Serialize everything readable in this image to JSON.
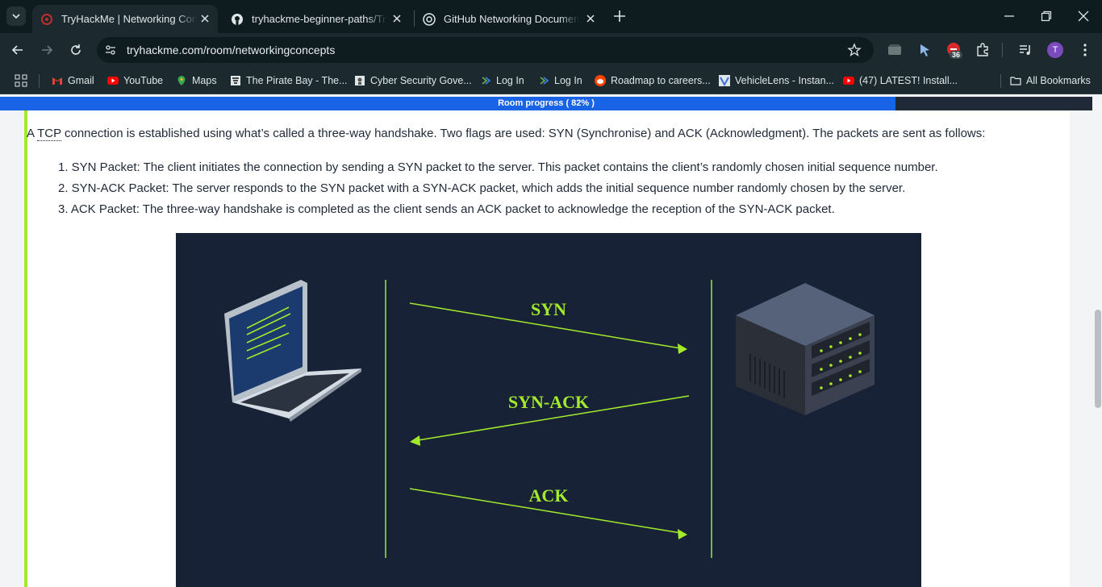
{
  "browser": {
    "tabs": [
      {
        "title": "TryHackMe | Networking Conce",
        "active": true
      },
      {
        "title": "tryhackme-beginner-paths/Tryh",
        "active": false
      },
      {
        "title": "GitHub Networking Documenta",
        "active": false
      }
    ],
    "url": "tryhackme.com/room/networkingconcepts",
    "extension_badge": "36",
    "profile_initial": "T",
    "bookmarks": [
      {
        "label": "Gmail",
        "icon": "gmail-icon"
      },
      {
        "label": "YouTube",
        "icon": "youtube-icon"
      },
      {
        "label": "Maps",
        "icon": "maps-icon"
      },
      {
        "label": "The Pirate Bay - The...",
        "icon": "piratebay-icon"
      },
      {
        "label": "Cyber Security Gove...",
        "icon": "govt-icon"
      },
      {
        "label": "Log In",
        "icon": "login-icon"
      },
      {
        "label": "Log In",
        "icon": "login-icon"
      },
      {
        "label": "Roadmap to careers...",
        "icon": "reddit-icon"
      },
      {
        "label": "VehicleLens - Instan...",
        "icon": "vehiclelens-icon"
      },
      {
        "label": "(47) LATEST! Install...",
        "icon": "youtube-icon"
      }
    ],
    "all_bookmarks_label": "All Bookmarks"
  },
  "page": {
    "progress_label": "Room progress ( 82% )",
    "progress_fraction": 0.82,
    "intro": {
      "prefix": "A ",
      "abbr": "TCP",
      "suffix": " connection is established using what’s called a three-way handshake. Two flags are used: SYN (Synchronise) and ACK (Acknowledgment). The packets are sent as follows:"
    },
    "steps": [
      "1. SYN Packet: The client initiates the connection by sending a SYN packet to the server. This packet contains the client’s randomly chosen initial sequence number.",
      "2. SYN-ACK Packet: The server responds to the SYN packet with a SYN-ACK packet, which adds the initial sequence number randomly chosen by the server.",
      "3. ACK Packet: The three-way handshake is completed as the client sends an ACK packet to acknowledge the reception of the SYN-ACK packet."
    ],
    "diagram": {
      "labels": {
        "syn": "SYN",
        "synack": "SYN-ACK",
        "ack": "ACK"
      },
      "accent": "#a3ea2a",
      "background": "#172237"
    }
  },
  "colors": {
    "progress": "#1863e6",
    "card_accent": "#a3ea2a"
  }
}
